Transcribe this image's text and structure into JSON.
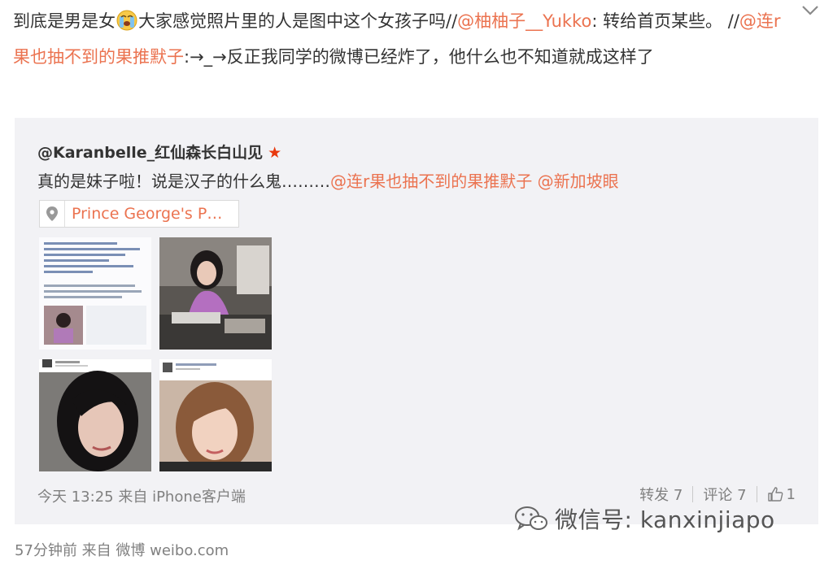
{
  "post": {
    "part1": "到底是男是女",
    "emoji_icon": "crying-face-emoji",
    "part2": "大家感觉照片里的人是图中这个女孩子吗//",
    "mention1": "@柚柚子__Yukko",
    "part3": ": 转给首页某些。 //",
    "mention2": "@连r果也抽不到的果推默子",
    "part4": ":→_→反正我同学的微博已经炸了，他什么也不知道就成这样了"
  },
  "repost": {
    "author": "@Karanbelle_红仙森长白山见",
    "badge_icon": "red-star-icon",
    "text": "真的是妹子啦！说是汉子的什么鬼………",
    "mention1": "@连r果也抽不到的果推默子",
    "mention2": "@新加坡眼",
    "location": "Prince George's P…",
    "time": "今天 13:25",
    "source": "来自 iPhone客户端",
    "repost_label": "转发 7",
    "comment_label": "评论 7",
    "like_count": "1"
  },
  "footer": {
    "time": "57分钟前",
    "source_label": "来自",
    "source": "微博 weibo.com"
  },
  "watermark": {
    "text": "微信号: kanxinjiapo"
  },
  "colors": {
    "mention": "#eb7350",
    "background": "#ffffff",
    "repost_bg": "#f2f2f5"
  }
}
